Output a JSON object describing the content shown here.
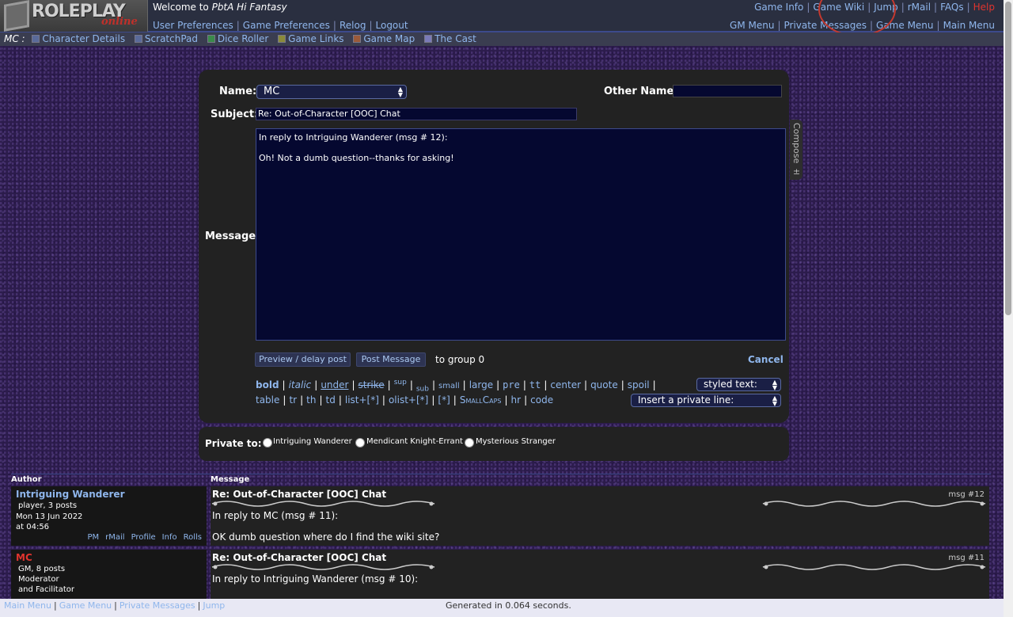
{
  "header": {
    "logo_text": "ROLEPLAY",
    "logo_sub": "online",
    "welcome_prefix": "Welcome to ",
    "game_name": "PbtA Hi Fantasy",
    "user_links": [
      "User Preferences",
      "Game Preferences",
      "Relog",
      "Logout"
    ],
    "top_right_links": [
      "Game Info",
      "Game Wiki",
      "Jump",
      "rMail",
      "FAQs"
    ],
    "help_link": "Help",
    "menu_links": [
      "GM Menu",
      "Private Messages",
      "Game Menu",
      "Main Menu"
    ]
  },
  "subnav": {
    "character": "MC :",
    "items": [
      "Character Details",
      "ScratchPad",
      "Dice Roller",
      "Game Links",
      "Game Map",
      "The Cast"
    ]
  },
  "compose": {
    "name_label": "Name:",
    "name_value": "MC",
    "other_name_label": "Other Name:",
    "subject_label": "Subject:",
    "subject_value": "Re: Out-of-Character [OOC] Chat",
    "message_label": "Message:",
    "message_text": "In reply to Intriguing Wanderer (msg # 12):\n\nOh! Not a dumb question--thanks for asking!",
    "compose_tab": "Compose ±",
    "preview_button": "Preview / delay post",
    "post_button": "Post Message",
    "to_group": "to group 0",
    "cancel": "Cancel",
    "format_row1": [
      "bold",
      "italic",
      "under",
      "strike",
      "sup",
      "sub",
      "small",
      "large",
      "pre",
      "tt",
      "center",
      "quote",
      "spoil"
    ],
    "format_row2": [
      "table",
      "tr",
      "th",
      "td",
      "list+[*]",
      "olist+[*]",
      "[*]",
      "SmallCaps",
      "hr",
      "code"
    ],
    "styled_text": "styled text:",
    "private_line": "Insert a private line:"
  },
  "private": {
    "label": "Private to:",
    "recipients": [
      "Intriguing Wanderer",
      "Mendicant Knight-Errant",
      "Mysterious Stranger"
    ]
  },
  "messages": {
    "col_author": "Author",
    "col_message": "Message",
    "rows": [
      {
        "author": "Intriguing Wanderer",
        "info1": "player, 3 posts",
        "info2": "Mon 13 Jun 2022",
        "info3": "at 04:56",
        "links": [
          "PM",
          "rMail",
          "Profile",
          "Info",
          "Rolls"
        ],
        "subject": "Re: Out-of-Character [OOC] Chat",
        "msgnum": "msg #12",
        "line1": "In reply to MC (msg # 11):",
        "line2": "OK dumb question where do I find the wiki site?"
      },
      {
        "author": "MC",
        "info1": "GM, 8 posts",
        "info2": "Moderator",
        "info3": "and Facilitator",
        "subject": "Re: Out-of-Character [OOC] Chat",
        "msgnum": "msg #11",
        "line1": "In reply to Intriguing Wanderer (msg # 10):"
      }
    ]
  },
  "footer": {
    "links": [
      "Main Menu",
      "Game Menu",
      "Private Messages",
      "Jump"
    ],
    "generated": "Generated in 0.064 seconds."
  },
  "colors": {
    "link": "#8fb6ec",
    "help_red": "#e0342e",
    "page_purple": "#2c1c4c",
    "panel": "#222222",
    "input_bg": "#050830"
  }
}
